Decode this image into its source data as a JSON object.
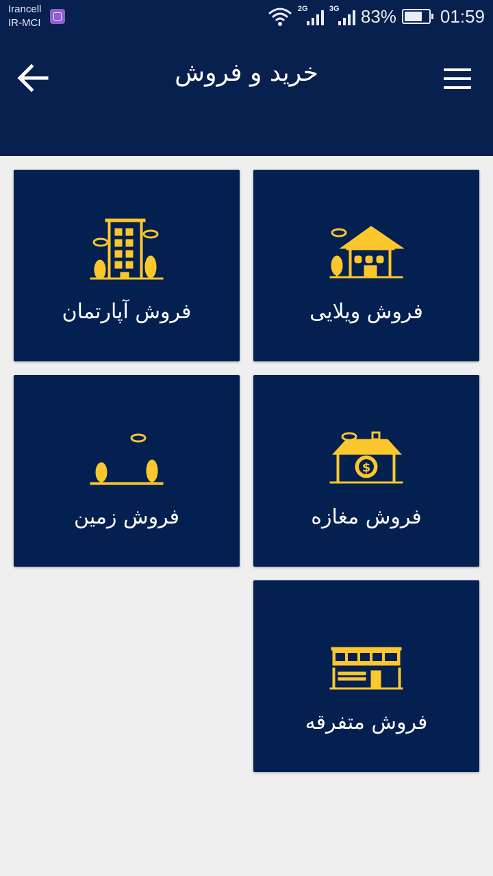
{
  "status": {
    "carrier1": "Irancell",
    "carrier2": "IR-MCI",
    "net1": "2G",
    "net2": "3G",
    "battery": "83%",
    "battery_level": 0.83,
    "time": "01:59"
  },
  "appbar": {
    "title": "خرید و فروش",
    "back_icon": "arrow-left-icon",
    "menu_icon": "hamburger-menu-icon"
  },
  "colors": {
    "primary": "#08204e",
    "card": "#032050",
    "icon": "#fcc72c",
    "background": "#efefef"
  },
  "cards": [
    {
      "label": "فروش ویلایی",
      "icon": "villa-house-icon"
    },
    {
      "label": "فروش آپارتمان",
      "icon": "apartment-building-icon"
    },
    {
      "label": "فروش مغازه",
      "icon": "shop-icon"
    },
    {
      "label": "فروش زمین",
      "icon": "land-icon"
    },
    {
      "label": "فروش متفرقه",
      "icon": "misc-building-icon"
    }
  ]
}
